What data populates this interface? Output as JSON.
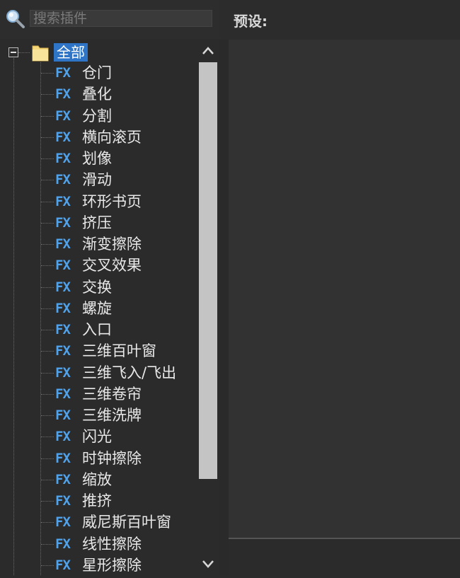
{
  "search": {
    "placeholder": "搜索插件"
  },
  "tree": {
    "root_label": "全部",
    "fx_badge": "FX",
    "items": [
      "仓门",
      "叠化",
      "分割",
      "横向滚页",
      "划像",
      "滑动",
      "环形书页",
      "挤压",
      "渐变擦除",
      "交叉效果",
      "交换",
      "螺旋",
      "入口",
      "三维百叶窗",
      "三维飞入/飞出",
      "三维卷帘",
      "三维洗牌",
      "闪光",
      "时钟擦除",
      "缩放",
      "推挤",
      "威尼斯百叶窗",
      "线性擦除",
      "星形擦除"
    ]
  },
  "preview": {
    "label": "预设:"
  },
  "scrollbar": {
    "position_fraction": 0.0,
    "visible_fraction": 0.85
  },
  "icons": {
    "search": "magnifier-icon",
    "folder": "folder-icon",
    "fx": "fx-effect-icon",
    "expander": "collapse-minus-icon",
    "scroll_up": "chevron-up-icon",
    "scroll_down": "chevron-down-icon"
  },
  "colors": {
    "background": "#2b2b2b",
    "selection": "#2f75c7",
    "fx_icon": "#4fa2ec",
    "text": "#e8e8e8",
    "scroll_thumb": "#c4c4c4",
    "folder": "#f3d77a"
  }
}
